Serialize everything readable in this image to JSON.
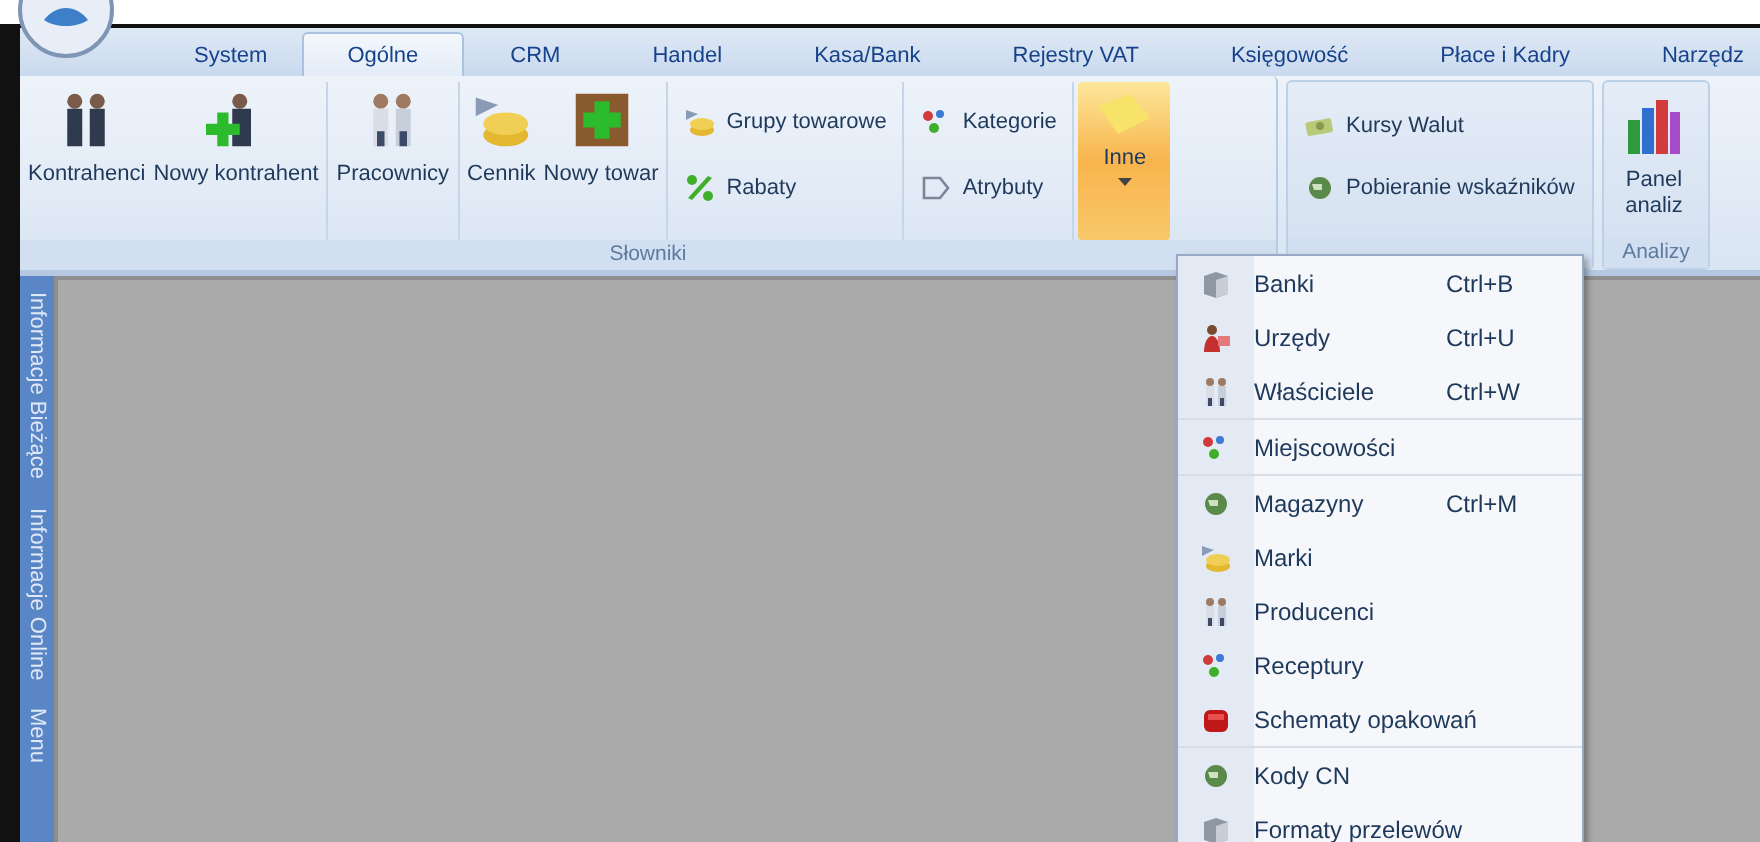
{
  "tabs": [
    {
      "label": "System",
      "selected": false
    },
    {
      "label": "Ogólne",
      "selected": true
    },
    {
      "label": "CRM",
      "selected": false
    },
    {
      "label": "Handel",
      "selected": false
    },
    {
      "label": "Kasa/Bank",
      "selected": false
    },
    {
      "label": "Rejestry VAT",
      "selected": false
    },
    {
      "label": "Księgowość",
      "selected": false
    },
    {
      "label": "Płace i Kadry",
      "selected": false
    },
    {
      "label": "Narzędz",
      "selected": false
    }
  ],
  "ribbon": {
    "groups": [
      {
        "label": "Słowniki",
        "columns": [
          {
            "kind": "large",
            "items": [
              {
                "label": "Kontrahenci"
              },
              {
                "label": "Nowy kontrahent"
              }
            ]
          },
          {
            "kind": "large",
            "items": [
              {
                "label": "Pracownicy"
              }
            ]
          },
          {
            "kind": "large",
            "items": [
              {
                "label": "Cennik"
              },
              {
                "label": "Nowy towar"
              }
            ]
          },
          {
            "kind": "stack",
            "items": [
              {
                "label": "Grupy towarowe"
              },
              {
                "label": "Rabaty"
              }
            ]
          },
          {
            "kind": "stack",
            "items": [
              {
                "label": "Kategorie"
              },
              {
                "label": "Atrybuty"
              }
            ]
          },
          {
            "kind": "dropdown",
            "items": [
              {
                "label": "Inne",
                "expanded": true
              }
            ]
          }
        ]
      },
      {
        "columns": [
          {
            "kind": "stack",
            "items": [
              {
                "label": "Kursy Walut"
              },
              {
                "label": "Pobieranie wskaźników"
              }
            ]
          }
        ]
      },
      {
        "label": "Analizy",
        "columns": [
          {
            "kind": "large",
            "items": [
              {
                "label": "Panel analiz"
              }
            ]
          }
        ]
      }
    ]
  },
  "side_tabs": [
    "Informacje Bieżące",
    "Informacje Online",
    "Menu"
  ],
  "menu": {
    "sections": [
      [
        {
          "label": "Banki",
          "shortcut": "Ctrl+B"
        },
        {
          "label": "Urzędy",
          "shortcut": "Ctrl+U"
        },
        {
          "label": "Właściciele",
          "shortcut": "Ctrl+W"
        }
      ],
      [
        {
          "label": "Miejscowości"
        }
      ],
      [
        {
          "label": "Magazyny",
          "shortcut": "Ctrl+M"
        },
        {
          "label": "Marki"
        },
        {
          "label": "Producenci"
        },
        {
          "label": "Receptury"
        },
        {
          "label": "Schematy opakowań"
        }
      ],
      [
        {
          "label": "Kody CN"
        },
        {
          "label": "Formaty przelewów"
        }
      ]
    ]
  }
}
